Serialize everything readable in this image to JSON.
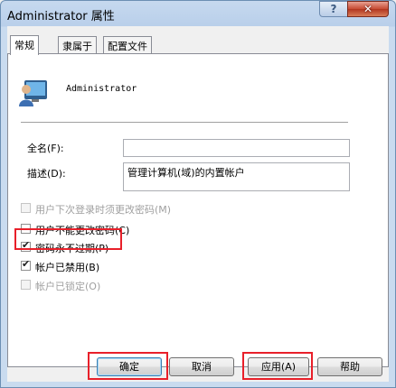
{
  "window": {
    "title": "Administrator 属性",
    "help_button": "?",
    "close_button": "✕"
  },
  "tabs": [
    {
      "label": "常规",
      "selected": true
    },
    {
      "label": "隶属于",
      "selected": false
    },
    {
      "label": "配置文件",
      "selected": false
    }
  ],
  "user": {
    "name": "Administrator",
    "icon": "user-icon"
  },
  "fields": {
    "fullname_label": "全名(F):",
    "fullname_value": "",
    "description_label": "描述(D):",
    "description_value": "管理计算机(域)的内置帐户"
  },
  "checkboxes": [
    {
      "label": "用户下次登录时须更改密码(M)",
      "checked": false,
      "enabled": false
    },
    {
      "label": "用户不能更改密码(C)",
      "checked": false,
      "enabled": true
    },
    {
      "label": "密码永不过期(P)",
      "checked": true,
      "enabled": true
    },
    {
      "label": "帐户已禁用(B)",
      "checked": true,
      "enabled": true
    },
    {
      "label": "帐户已锁定(O)",
      "checked": false,
      "enabled": false
    }
  ],
  "buttons": {
    "ok": "确定",
    "cancel": "取消",
    "apply": "应用(A)",
    "help": "帮助"
  },
  "colors": {
    "highlight": "#e8202a",
    "title_bar": "#b9cfea",
    "close_button": "#c74a32"
  }
}
